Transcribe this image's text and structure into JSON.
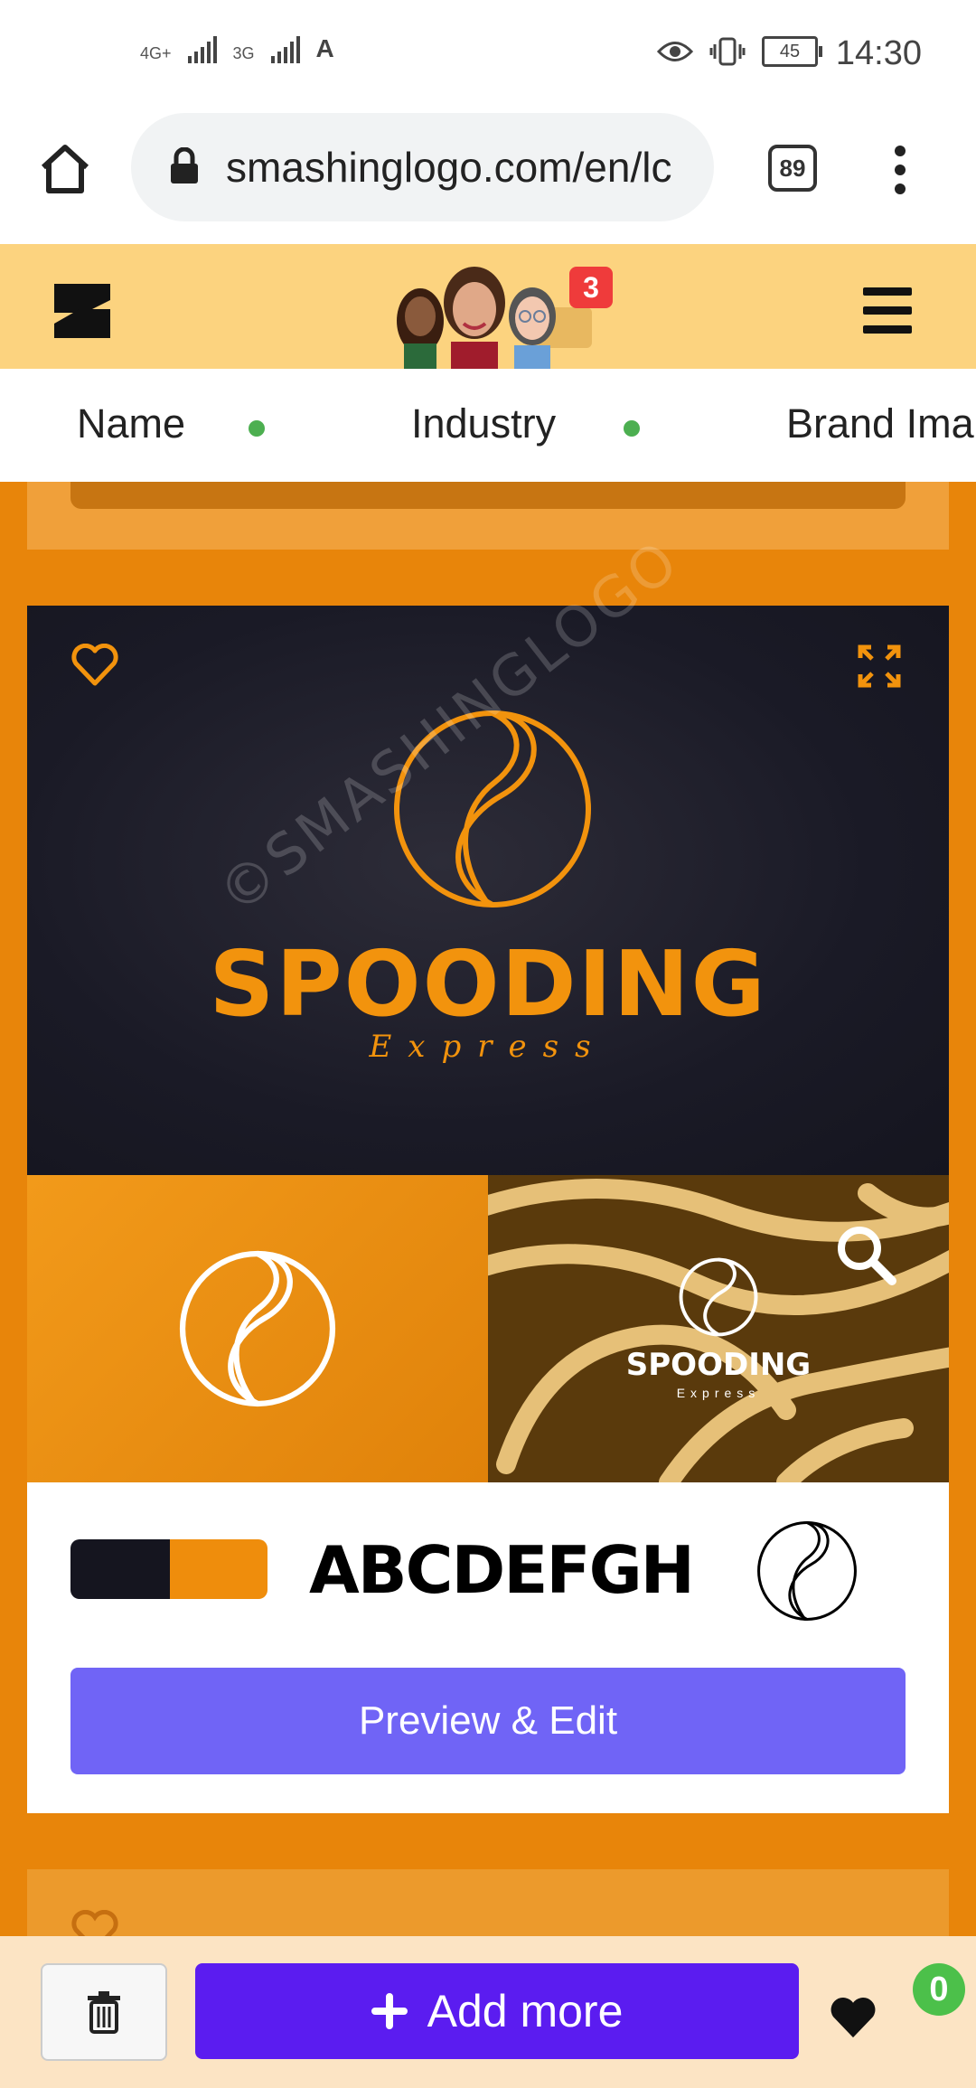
{
  "status_bar": {
    "network1": "4G+",
    "network2": "3G",
    "battery": "45",
    "time": "14:30"
  },
  "browser": {
    "url": "smashinglogo.com/en/lc",
    "tab_count": "89"
  },
  "header": {
    "notification_count": "3"
  },
  "steps": [
    {
      "label": "Name",
      "status_color": "#4caf50"
    },
    {
      "label": "Industry",
      "status_color": "#4caf50"
    },
    {
      "label": "Brand Ima"
    }
  ],
  "logo_card": {
    "brand_name": "SPOODING",
    "tagline": "Express",
    "watermark": "©SMASHINGLOGO",
    "mockup_brand_name": "SPOODING",
    "mockup_tagline": "Express",
    "palette": [
      "#15151f",
      "#ef8d0c"
    ],
    "font_sample": "ABCDEFGH",
    "edit_button": "Preview & Edit",
    "accent_color": "#f2930d"
  },
  "bottom_bar": {
    "add_more_label": "Add more",
    "favorites_count": "0"
  }
}
